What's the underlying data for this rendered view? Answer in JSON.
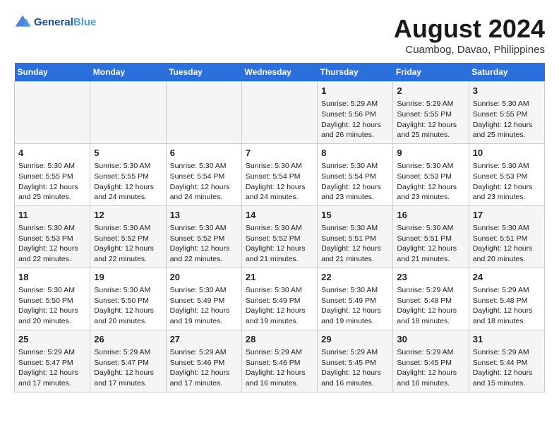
{
  "header": {
    "logo_line1": "General",
    "logo_line2": "Blue",
    "month_year": "August 2024",
    "location": "Cuambog, Davao, Philippines"
  },
  "days_of_week": [
    "Sunday",
    "Monday",
    "Tuesday",
    "Wednesday",
    "Thursday",
    "Friday",
    "Saturday"
  ],
  "weeks": [
    [
      {
        "day": "",
        "info": ""
      },
      {
        "day": "",
        "info": ""
      },
      {
        "day": "",
        "info": ""
      },
      {
        "day": "",
        "info": ""
      },
      {
        "day": "1",
        "info": "Sunrise: 5:29 AM\nSunset: 5:56 PM\nDaylight: 12 hours\nand 26 minutes."
      },
      {
        "day": "2",
        "info": "Sunrise: 5:29 AM\nSunset: 5:55 PM\nDaylight: 12 hours\nand 25 minutes."
      },
      {
        "day": "3",
        "info": "Sunrise: 5:30 AM\nSunset: 5:55 PM\nDaylight: 12 hours\nand 25 minutes."
      }
    ],
    [
      {
        "day": "4",
        "info": "Sunrise: 5:30 AM\nSunset: 5:55 PM\nDaylight: 12 hours\nand 25 minutes."
      },
      {
        "day": "5",
        "info": "Sunrise: 5:30 AM\nSunset: 5:55 PM\nDaylight: 12 hours\nand 24 minutes."
      },
      {
        "day": "6",
        "info": "Sunrise: 5:30 AM\nSunset: 5:54 PM\nDaylight: 12 hours\nand 24 minutes."
      },
      {
        "day": "7",
        "info": "Sunrise: 5:30 AM\nSunset: 5:54 PM\nDaylight: 12 hours\nand 24 minutes."
      },
      {
        "day": "8",
        "info": "Sunrise: 5:30 AM\nSunset: 5:54 PM\nDaylight: 12 hours\nand 23 minutes."
      },
      {
        "day": "9",
        "info": "Sunrise: 5:30 AM\nSunset: 5:53 PM\nDaylight: 12 hours\nand 23 minutes."
      },
      {
        "day": "10",
        "info": "Sunrise: 5:30 AM\nSunset: 5:53 PM\nDaylight: 12 hours\nand 23 minutes."
      }
    ],
    [
      {
        "day": "11",
        "info": "Sunrise: 5:30 AM\nSunset: 5:53 PM\nDaylight: 12 hours\nand 22 minutes."
      },
      {
        "day": "12",
        "info": "Sunrise: 5:30 AM\nSunset: 5:52 PM\nDaylight: 12 hours\nand 22 minutes."
      },
      {
        "day": "13",
        "info": "Sunrise: 5:30 AM\nSunset: 5:52 PM\nDaylight: 12 hours\nand 22 minutes."
      },
      {
        "day": "14",
        "info": "Sunrise: 5:30 AM\nSunset: 5:52 PM\nDaylight: 12 hours\nand 21 minutes."
      },
      {
        "day": "15",
        "info": "Sunrise: 5:30 AM\nSunset: 5:51 PM\nDaylight: 12 hours\nand 21 minutes."
      },
      {
        "day": "16",
        "info": "Sunrise: 5:30 AM\nSunset: 5:51 PM\nDaylight: 12 hours\nand 21 minutes."
      },
      {
        "day": "17",
        "info": "Sunrise: 5:30 AM\nSunset: 5:51 PM\nDaylight: 12 hours\nand 20 minutes."
      }
    ],
    [
      {
        "day": "18",
        "info": "Sunrise: 5:30 AM\nSunset: 5:50 PM\nDaylight: 12 hours\nand 20 minutes."
      },
      {
        "day": "19",
        "info": "Sunrise: 5:30 AM\nSunset: 5:50 PM\nDaylight: 12 hours\nand 20 minutes."
      },
      {
        "day": "20",
        "info": "Sunrise: 5:30 AM\nSunset: 5:49 PM\nDaylight: 12 hours\nand 19 minutes."
      },
      {
        "day": "21",
        "info": "Sunrise: 5:30 AM\nSunset: 5:49 PM\nDaylight: 12 hours\nand 19 minutes."
      },
      {
        "day": "22",
        "info": "Sunrise: 5:30 AM\nSunset: 5:49 PM\nDaylight: 12 hours\nand 19 minutes."
      },
      {
        "day": "23",
        "info": "Sunrise: 5:29 AM\nSunset: 5:48 PM\nDaylight: 12 hours\nand 18 minutes."
      },
      {
        "day": "24",
        "info": "Sunrise: 5:29 AM\nSunset: 5:48 PM\nDaylight: 12 hours\nand 18 minutes."
      }
    ],
    [
      {
        "day": "25",
        "info": "Sunrise: 5:29 AM\nSunset: 5:47 PM\nDaylight: 12 hours\nand 17 minutes."
      },
      {
        "day": "26",
        "info": "Sunrise: 5:29 AM\nSunset: 5:47 PM\nDaylight: 12 hours\nand 17 minutes."
      },
      {
        "day": "27",
        "info": "Sunrise: 5:29 AM\nSunset: 5:46 PM\nDaylight: 12 hours\nand 17 minutes."
      },
      {
        "day": "28",
        "info": "Sunrise: 5:29 AM\nSunset: 5:46 PM\nDaylight: 12 hours\nand 16 minutes."
      },
      {
        "day": "29",
        "info": "Sunrise: 5:29 AM\nSunset: 5:45 PM\nDaylight: 12 hours\nand 16 minutes."
      },
      {
        "day": "30",
        "info": "Sunrise: 5:29 AM\nSunset: 5:45 PM\nDaylight: 12 hours\nand 16 minutes."
      },
      {
        "day": "31",
        "info": "Sunrise: 5:29 AM\nSunset: 5:44 PM\nDaylight: 12 hours\nand 15 minutes."
      }
    ]
  ]
}
